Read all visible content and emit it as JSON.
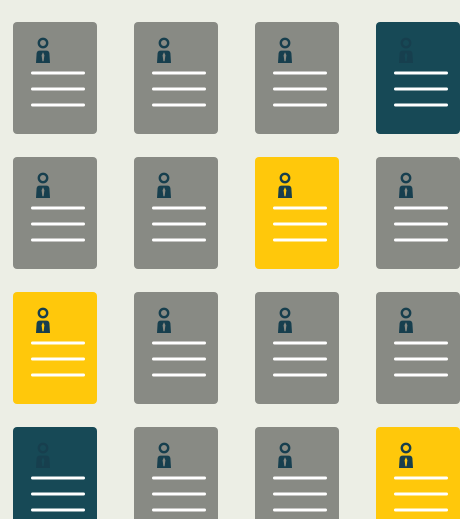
{
  "colors": {
    "background": "#eceee5",
    "gray": "#888a84",
    "teal": "#174956",
    "yellow": "#ffc80b",
    "line": "#ffffff",
    "person": "#173f4e"
  },
  "grid": {
    "rows": 4,
    "columns": 4
  },
  "cards": [
    {
      "variant": "gray",
      "icon": "person-icon"
    },
    {
      "variant": "gray",
      "icon": "person-icon"
    },
    {
      "variant": "gray",
      "icon": "person-icon"
    },
    {
      "variant": "teal",
      "icon": "person-icon"
    },
    {
      "variant": "gray",
      "icon": "person-icon"
    },
    {
      "variant": "gray",
      "icon": "person-icon"
    },
    {
      "variant": "yellow",
      "icon": "person-icon"
    },
    {
      "variant": "gray",
      "icon": "person-icon"
    },
    {
      "variant": "yellow",
      "icon": "person-icon"
    },
    {
      "variant": "gray",
      "icon": "person-icon"
    },
    {
      "variant": "gray",
      "icon": "person-icon"
    },
    {
      "variant": "gray",
      "icon": "person-icon"
    },
    {
      "variant": "teal",
      "icon": "person-icon"
    },
    {
      "variant": "gray",
      "icon": "person-icon"
    },
    {
      "variant": "gray",
      "icon": "person-icon"
    },
    {
      "variant": "yellow",
      "icon": "person-icon"
    }
  ]
}
